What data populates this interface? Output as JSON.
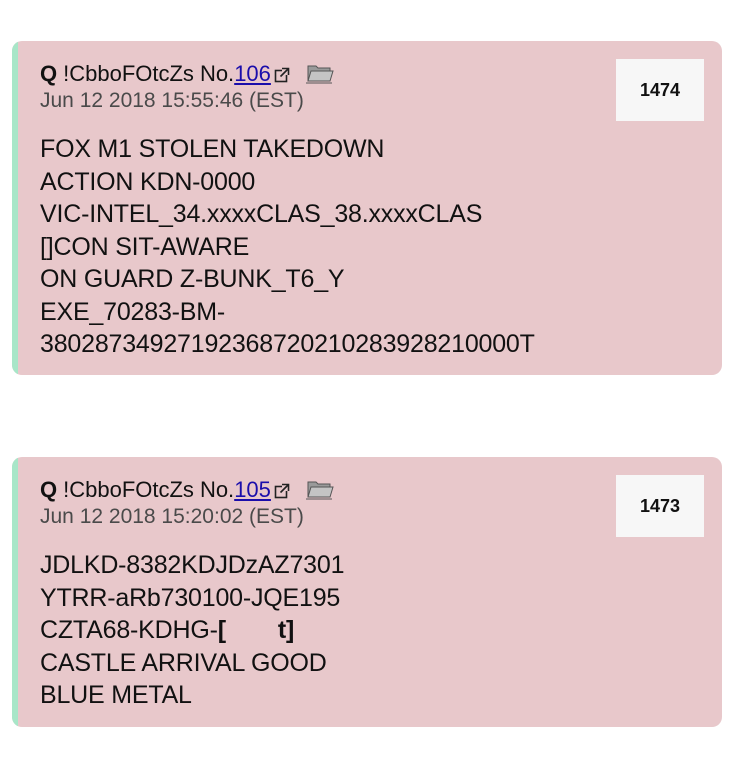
{
  "posts": [
    {
      "name": "Q",
      "tripcode": "!CbboFOtcZs",
      "no_label": "No.",
      "post_number": "106",
      "timestamp": "Jun 12 2018 15:55:46 (EST)",
      "badge_number": "1474",
      "lines": [
        "FOX M1 STOLEN TAKEDOWN",
        "ACTION KDN-0000",
        "VIC-INTEL_34.xxxxCLAS_38.xxxxCLAS",
        "[]CON SIT-AWARE",
        "ON GUARD Z-BUNK_T6_Y",
        "EXE_70283-BM-",
        "38028734927192368720210283928210000T"
      ]
    },
    {
      "name": "Q",
      "tripcode": "!CbboFOtcZs",
      "no_label": "No.",
      "post_number": "105",
      "timestamp": "Jun 12 2018 15:20:02 (EST)",
      "badge_number": "1473",
      "lines": [
        "JDLKD-8382KDJDzAZ7301",
        "YTRR-aRb730100-JQE195",
        "CZTA68-KDHG-",
        "CASTLE ARRIVAL GOOD",
        "BLUE METAL"
      ],
      "line3_bracket_open": "[",
      "line3_bracket_close": "t]"
    }
  ],
  "colors": {
    "post_background": "#e8c8cb",
    "left_stripe": "#a8e6c8",
    "link": "#1a0dab",
    "badge_background": "#f7f7f7"
  },
  "icons": [
    "external-link-icon",
    "folder-icon"
  ]
}
